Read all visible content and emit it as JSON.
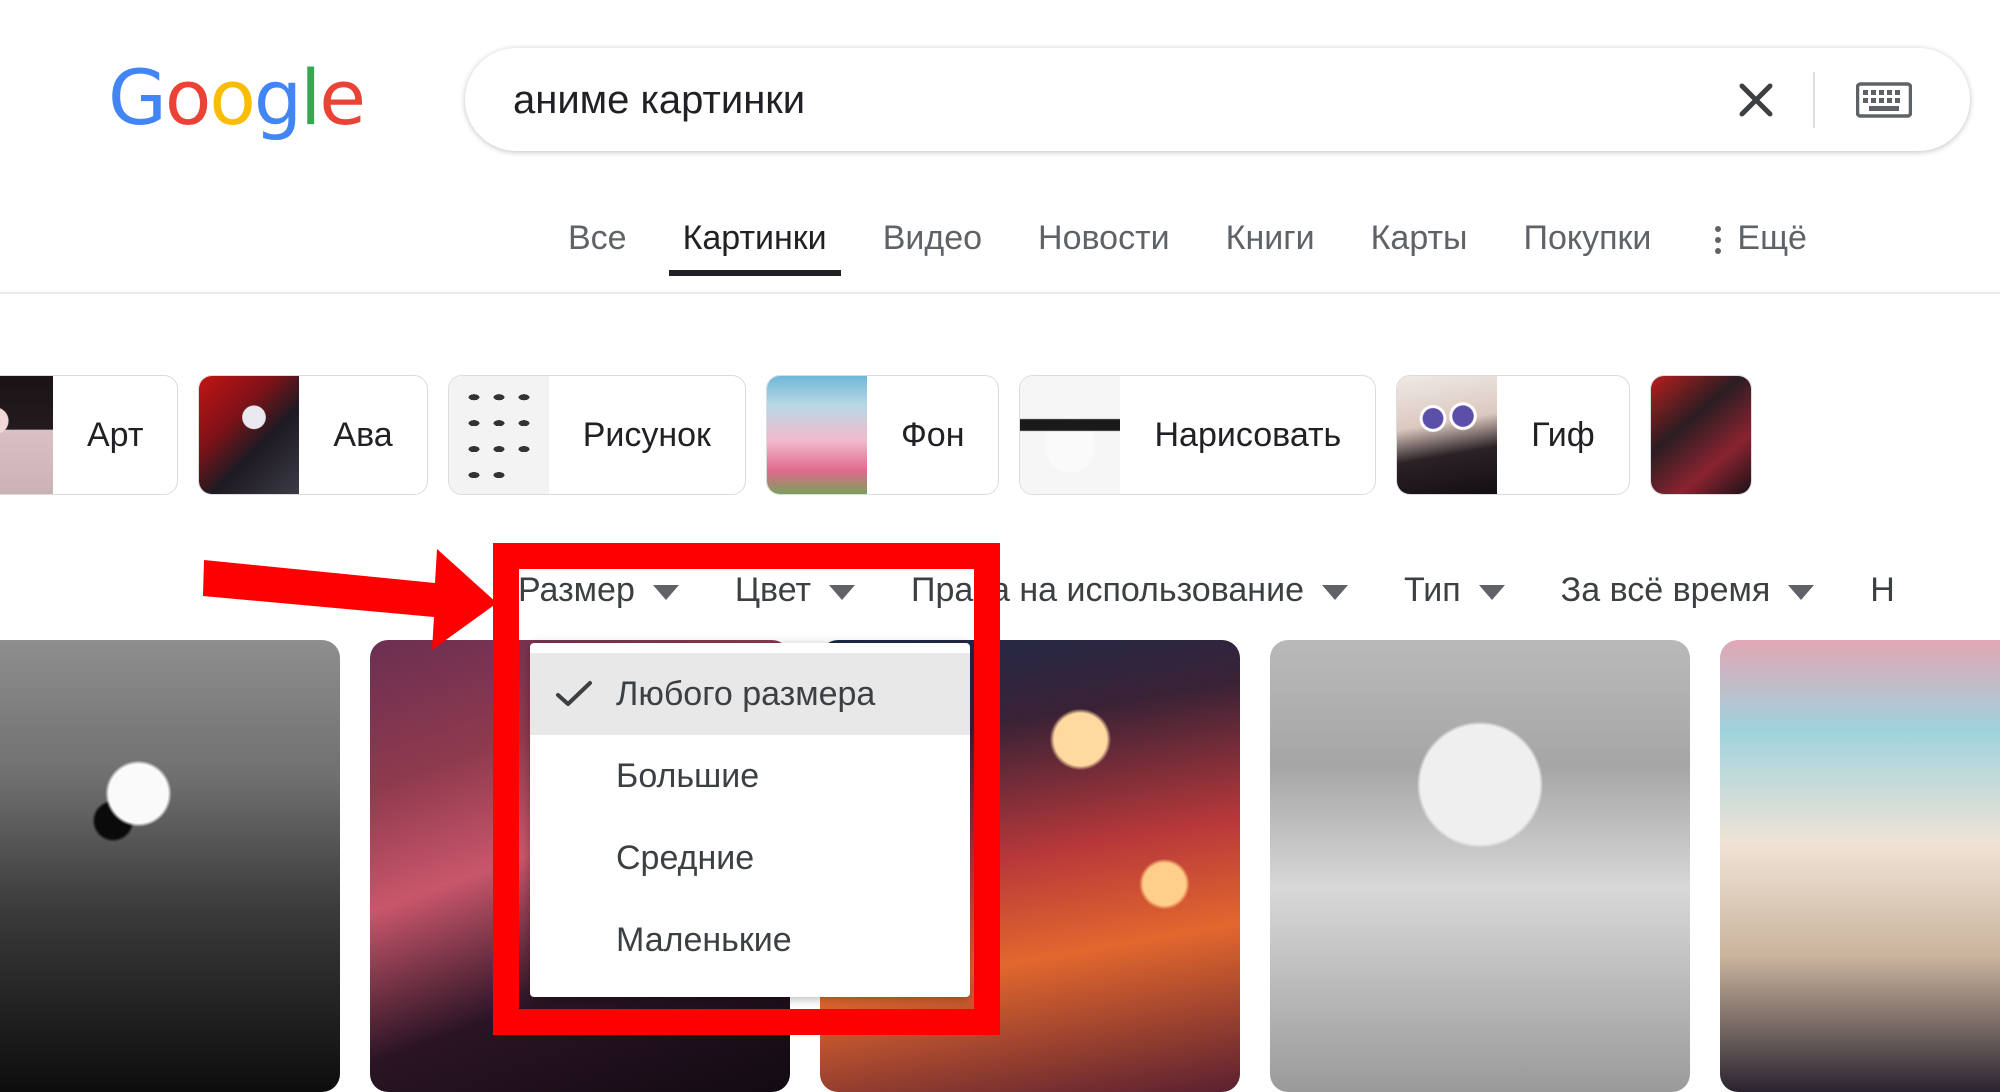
{
  "brand": {
    "logo_letters": [
      "G",
      "o",
      "o",
      "g",
      "l",
      "e"
    ]
  },
  "search": {
    "query": "аниме картинки",
    "clear_icon": "close-icon",
    "keyboard_icon": "keyboard-icon"
  },
  "nav": {
    "tabs": [
      {
        "label": "Все",
        "active": false
      },
      {
        "label": "Картинки",
        "active": true
      },
      {
        "label": "Видео",
        "active": false
      },
      {
        "label": "Новости",
        "active": false
      },
      {
        "label": "Книги",
        "active": false
      },
      {
        "label": "Карты",
        "active": false
      },
      {
        "label": "Покупки",
        "active": false
      }
    ],
    "more_label": "Ещё",
    "more_icon": "more-vert-icon"
  },
  "chips": [
    {
      "label": "Арт"
    },
    {
      "label": "Ава"
    },
    {
      "label": "Рисунок"
    },
    {
      "label": "Фон"
    },
    {
      "label": "Нарисовать"
    },
    {
      "label": "Гиф"
    }
  ],
  "filters": [
    {
      "label": "Размер",
      "has_caret": true,
      "open": true
    },
    {
      "label": "Цвет",
      "has_caret": true,
      "open": false
    },
    {
      "label": "Права на использование",
      "has_caret": true,
      "open": false
    },
    {
      "label": "Тип",
      "has_caret": true,
      "open": false
    },
    {
      "label": "За всё время",
      "has_caret": true,
      "open": false
    },
    {
      "label": "Н",
      "has_caret": false,
      "open": false
    }
  ],
  "size_dropdown": {
    "items": [
      {
        "label": "Любого размера",
        "selected": true
      },
      {
        "label": "Большие",
        "selected": false
      },
      {
        "label": "Средние",
        "selected": false
      },
      {
        "label": "Маленькие",
        "selected": false
      }
    ],
    "check_icon": "check-icon"
  },
  "results": [
    {
      "alt": "anime-girl-with-flowers-grayscale"
    },
    {
      "alt": "anime-character-purple-pink"
    },
    {
      "alt": "anime-girl-city-lights-red"
    },
    {
      "alt": "anime-boy-white-hair-grayscale"
    },
    {
      "alt": "anime-girl-pink-sky"
    }
  ],
  "annotations": {
    "arrow_color": "#ff0000",
    "box_color": "#ff0000",
    "arrow_name": "red-pointer-arrow",
    "box_name": "red-highlight-box"
  }
}
